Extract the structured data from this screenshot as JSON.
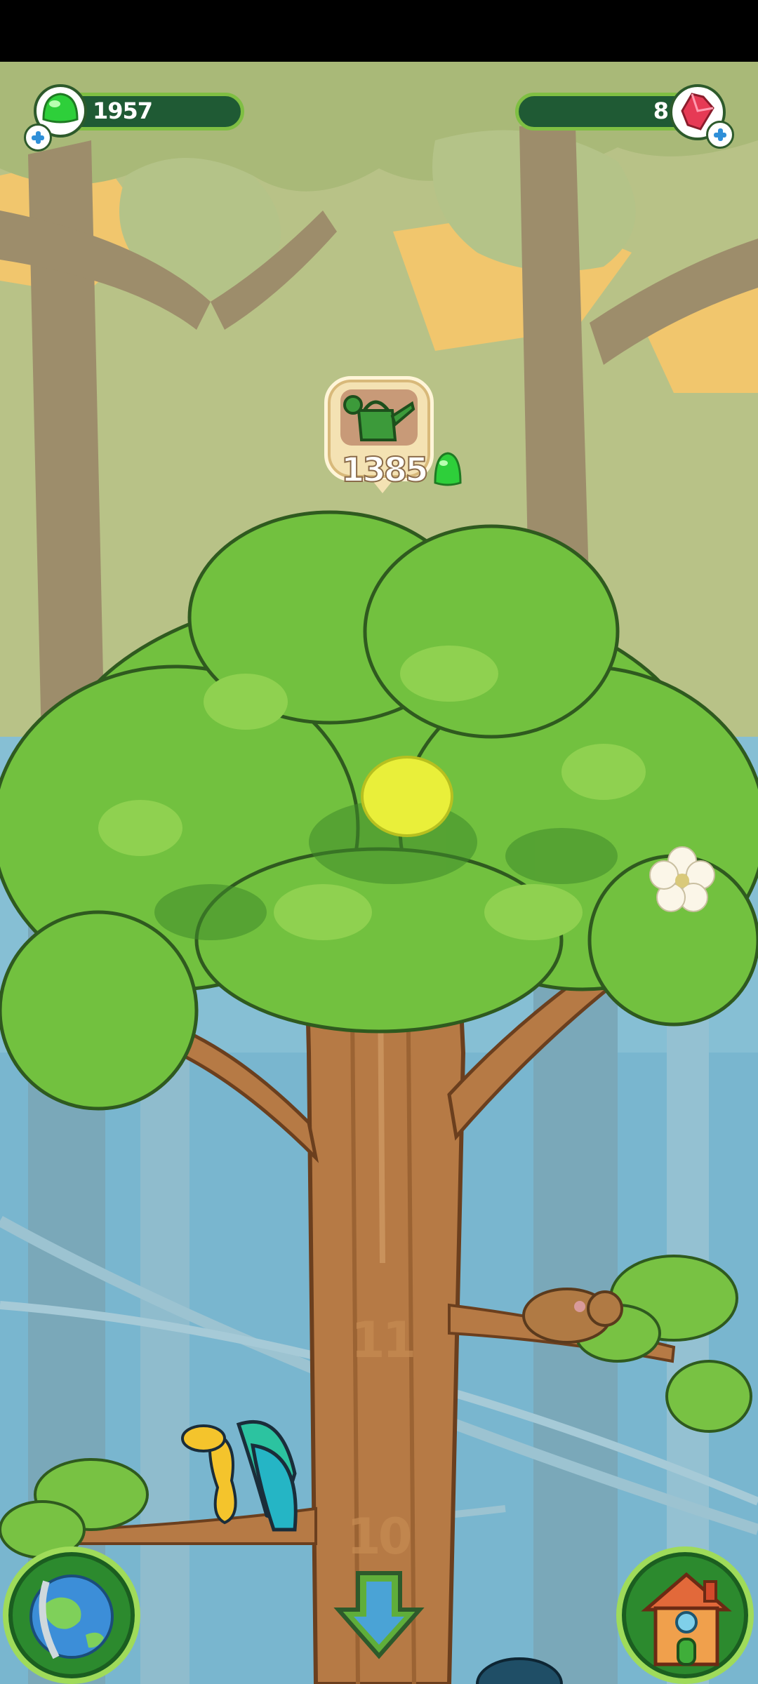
{
  "hud": {
    "gel_count": "1957",
    "ruby_count": "8"
  },
  "watering_can": {
    "cost": "1385"
  },
  "tree": {
    "levels": [
      "11",
      "10"
    ]
  },
  "colors": {
    "sky_top": "#b6c183",
    "sunlight": "#f3c76c",
    "back_trees": "#9a8f6e",
    "forest_blue": "#7fb9cf",
    "leaves": "#72c13f",
    "leaves_dark": "#3d8a2a",
    "trunk": "#b97a46",
    "hud_bar": "#1f5a34",
    "hud_border": "#7fbf43"
  },
  "icons": {
    "gel": "green-gel-icon",
    "ruby": "ruby-gem-icon",
    "add": "plus-icon",
    "can": "watering-can-icon",
    "map": "globe-icon",
    "home": "house-icon",
    "down": "down-arrow-icon"
  }
}
